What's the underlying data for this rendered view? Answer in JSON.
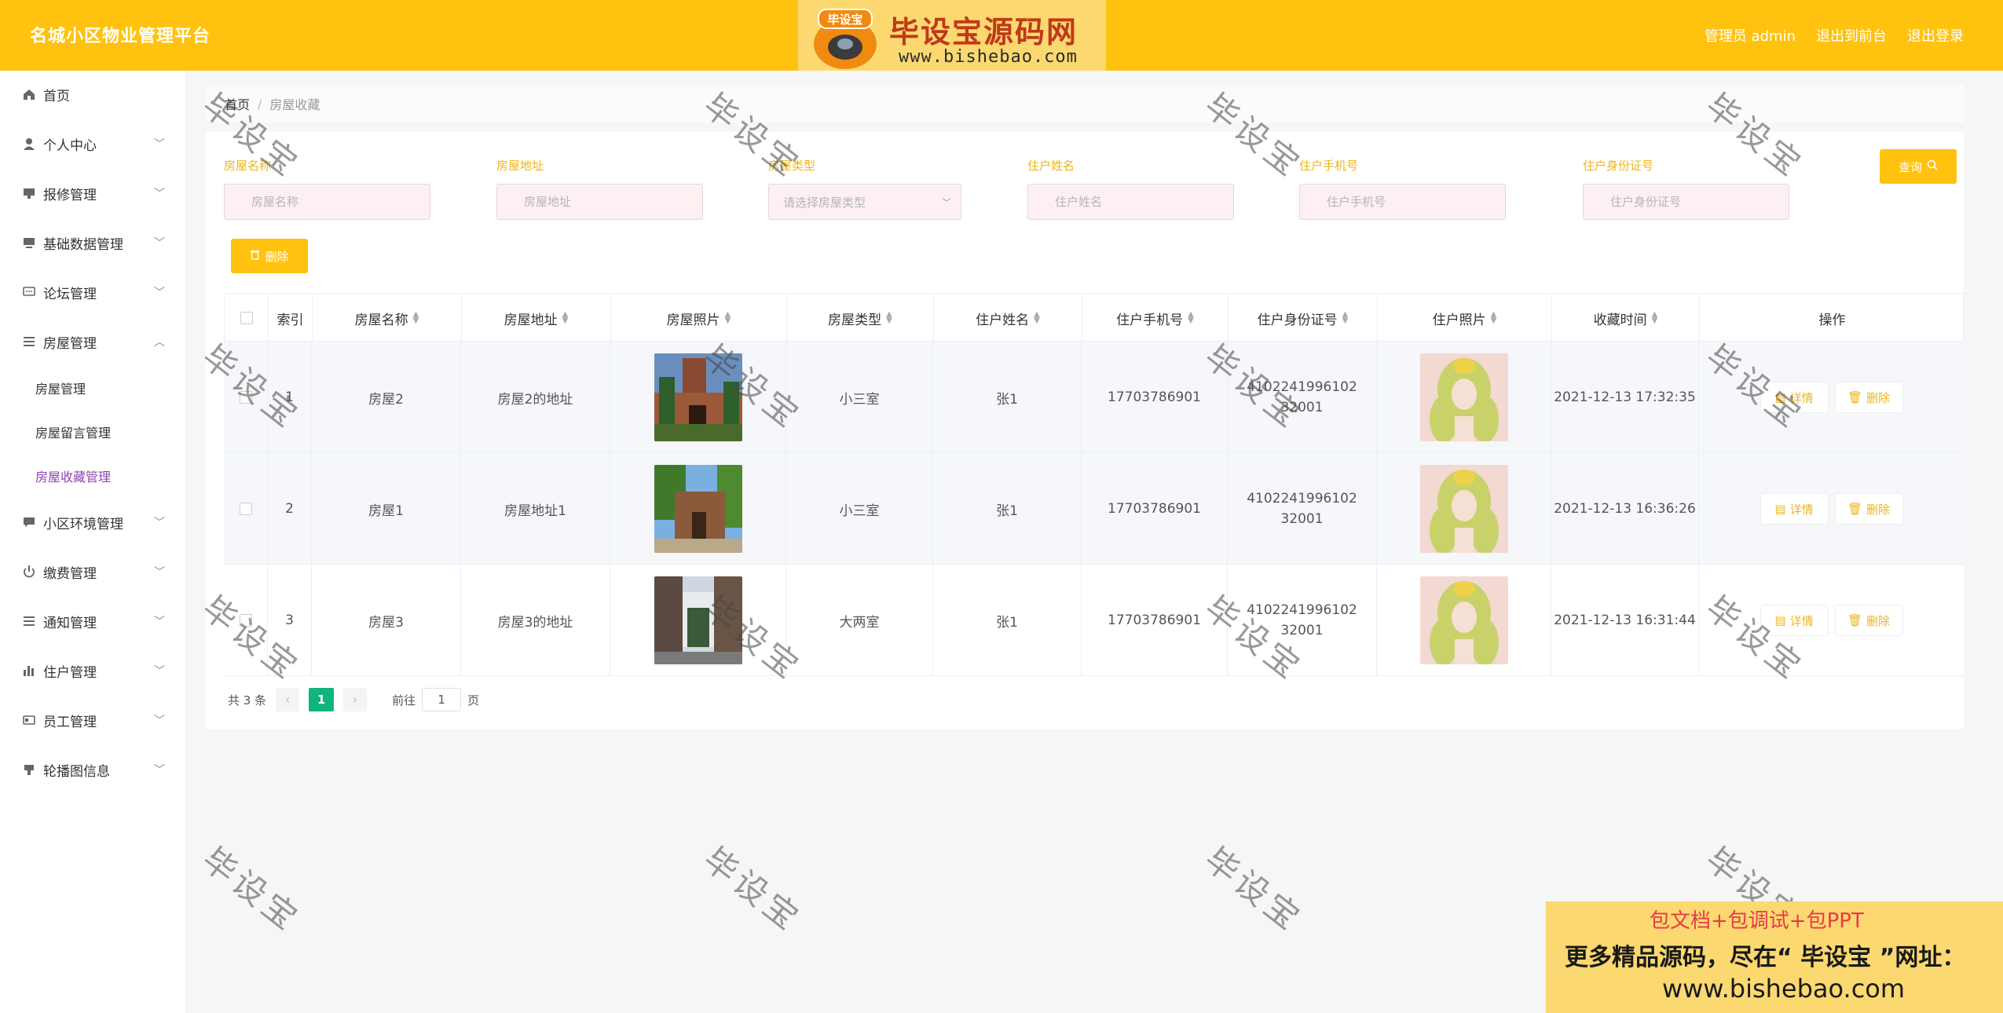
{
  "header": {
    "title": "名城小区物业管理平台",
    "admin_label": "管理员 admin",
    "to_front_label": "退出到前台",
    "logout_label": "退出登录"
  },
  "logo": {
    "badge": "毕设宝",
    "name": "毕设宝源码网",
    "url": "www.bishebao.com"
  },
  "sidebar": {
    "items": [
      {
        "label": "首页",
        "icon": "home-icon"
      },
      {
        "label": "个人中心",
        "icon": "user-icon"
      },
      {
        "label": "报修管理",
        "icon": "repair-icon"
      },
      {
        "label": "基础数据管理",
        "icon": "monitor-icon"
      },
      {
        "label": "论坛管理",
        "icon": "chat-icon"
      },
      {
        "label": "房屋管理",
        "icon": "menu-icon"
      },
      {
        "label": "小区环境管理",
        "icon": "comment-icon"
      },
      {
        "label": "缴费管理",
        "icon": "power-icon"
      },
      {
        "label": "通知管理",
        "icon": "menu-icon"
      },
      {
        "label": "住户管理",
        "icon": "chart-icon"
      },
      {
        "label": "员工管理",
        "icon": "card-icon"
      },
      {
        "label": "轮播图信息",
        "icon": "stamp-icon"
      }
    ],
    "sub_items": [
      "房屋管理",
      "房屋留言管理",
      "房屋收藏管理"
    ]
  },
  "breadcrumb": {
    "home": "首页",
    "current": "房屋收藏"
  },
  "search": {
    "labels": [
      "房屋名称",
      "房屋地址",
      "房屋类型",
      "住户姓名",
      "住户手机号",
      "住户身份证号"
    ],
    "placeholders": [
      "房屋名称",
      "房屋地址",
      "请选择房屋类型",
      "住户姓名",
      "住户手机号",
      "住户身份证号"
    ],
    "query_label": "查询",
    "delete_label": "删除"
  },
  "table": {
    "headers": [
      "索引",
      "房屋名称",
      "房屋地址",
      "房屋照片",
      "房屋类型",
      "住户姓名",
      "住户手机号",
      "住户身份证号",
      "住户照片",
      "收藏时间",
      "操作"
    ],
    "detail_label": "详情",
    "delete_label": "删除",
    "rows": [
      {
        "index": "1",
        "name": "房屋2",
        "address": "房屋2的地址",
        "type": "小三室",
        "resident": "张1",
        "phone": "17703786901",
        "idcard": "410224199610232001",
        "time": "2021-12-13 17:32:35"
      },
      {
        "index": "2",
        "name": "房屋1",
        "address": "房屋地址1",
        "type": "小三室",
        "resident": "张1",
        "phone": "17703786901",
        "idcard": "410224199610232001",
        "time": "2021-12-13 16:36:26"
      },
      {
        "index": "3",
        "name": "房屋3",
        "address": "房屋3的地址",
        "type": "大两室",
        "resident": "张1",
        "phone": "17703786901",
        "idcard": "410224199610232001",
        "time": "2021-12-13 16:31:44"
      }
    ]
  },
  "pagination": {
    "total": "共 3 条",
    "current": "1",
    "goto_prefix": "前往",
    "goto_value": "1",
    "goto_suffix": "页"
  },
  "watermark": "毕设宝",
  "ad": {
    "line1": "包文档+包调试+包PPT",
    "line2": "更多精品源码，尽在“ 毕设宝 ”网址：",
    "line3": "www.bishebao.com"
  },
  "colors": {
    "accent": "#fec20f",
    "active_menu": "#8e44ad",
    "page_active": "#10b47e"
  }
}
